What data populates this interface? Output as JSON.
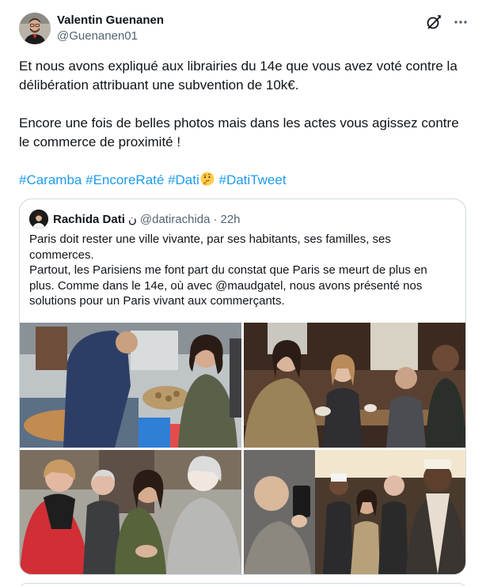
{
  "author": {
    "name": "Valentin Guenanen",
    "handle": "@Guenanen01"
  },
  "icons": {
    "avatar": "person-avatar",
    "grok": "grok-icon",
    "more": "more-horizontal-icon",
    "emoji": "thinking-face-emoji"
  },
  "tweet": {
    "para1": "Et nous avons expliqué aux librairies du 14e que vous avez voté contre la délibération attribuant une subvention de 10k€.",
    "para2": "Encore une fois de belles photos mais dans les actes vous agissez contre le commerce de proximité !",
    "hashtags": [
      "#Caramba",
      "#EncoreRaté",
      "#Dati",
      "#DatiTweet"
    ]
  },
  "quote": {
    "name": "Rachida Dati",
    "affiliation_glyph": "ن",
    "handle": "@datirachida",
    "separator": "·",
    "time": "22h",
    "lines": [
      "Paris doit rester une ville vivante, par ses habitants, ses familles, ses",
      "commerces.",
      "Partout, les Parisiens me font part du constat que Paris se meurt de plus en",
      "plus. Comme dans le 14e, où avec @maudgatel, nous avons présenté nos",
      "solutions pour un Paris vivant aux commerçants."
    ],
    "photos": [
      "market-stall-photo",
      "cafe-meeting-photo",
      "street-greeting-photo",
      "selfie-group-photo"
    ]
  },
  "colors": {
    "link": "#1d9bf0",
    "text": "#0f1419",
    "secondary": "#536471",
    "border": "#cfd9de"
  }
}
